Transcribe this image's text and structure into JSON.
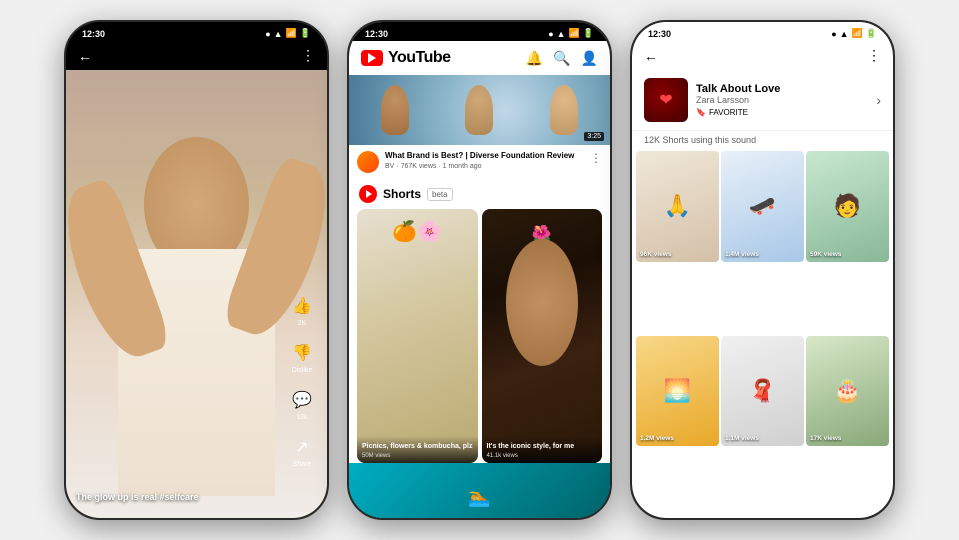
{
  "phones": [
    {
      "id": "phone1",
      "status_time": "12:30",
      "type": "short_video",
      "caption": "The glow up is real #selfcare",
      "actions": [
        {
          "icon": "👍",
          "label": "2K"
        },
        {
          "icon": "👎",
          "label": "Dislike"
        },
        {
          "icon": "💬",
          "label": "12k"
        },
        {
          "icon": "↗",
          "label": "Share"
        }
      ]
    },
    {
      "id": "phone2",
      "status_time": "12:30",
      "type": "youtube_home",
      "logo_text": "YouTube",
      "video": {
        "title": "What Brand is Best? | Diverse Foundation Review",
        "channel": "BV",
        "views": "767K views",
        "age": "1 month ago",
        "duration": "3:25"
      },
      "shorts": {
        "label": "Shorts",
        "badge": "beta",
        "items": [
          {
            "title": "Picnics, flowers & kombucha, plz",
            "views": "50M views"
          },
          {
            "title": "It's the iconic style, for me",
            "views": "41.1k views"
          }
        ]
      }
    },
    {
      "id": "phone3",
      "status_time": "12:30",
      "type": "shorts_sound",
      "song": {
        "title": "Talk About Love",
        "artist": "Zara Larsson",
        "favorite_label": "FAVORITE"
      },
      "sounds_count": "12K Shorts using this sound",
      "grid_items": [
        {
          "views": "96K views"
        },
        {
          "views": "1.4M views"
        },
        {
          "views": "59K views"
        },
        {
          "views": "1.2M views"
        },
        {
          "views": "1.1M views"
        },
        {
          "views": "17K views"
        }
      ]
    }
  ]
}
